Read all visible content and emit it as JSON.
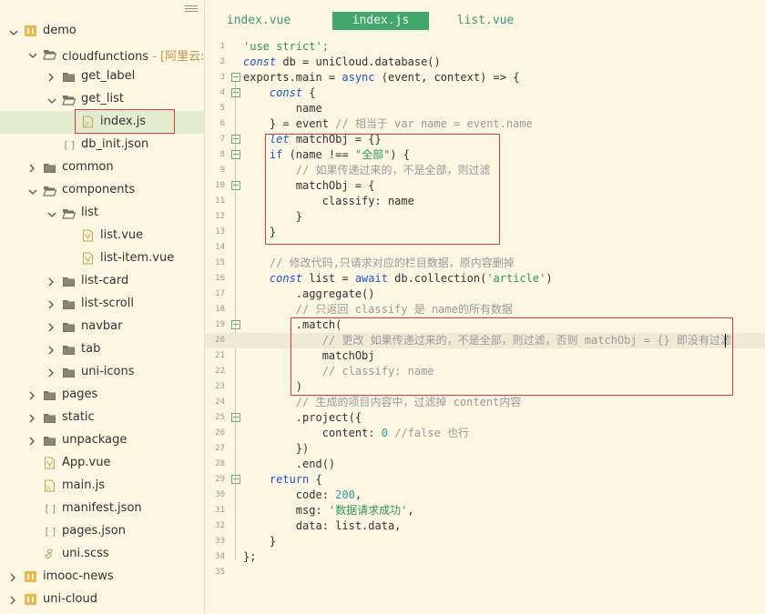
{
  "sidebar": {
    "items": [
      {
        "label": "demo",
        "icon": "project-folder-icon",
        "depth": 0,
        "arrow": "down"
      },
      {
        "label": "cloudfunctions",
        "sub": " - [阿里云:zk",
        "icon": "open-folder-icon",
        "depth": 1,
        "arrow": "down"
      },
      {
        "label": "get_label",
        "icon": "folder-icon",
        "depth": 2,
        "arrow": "right"
      },
      {
        "label": "get_list",
        "icon": "open-folder-icon",
        "depth": 2,
        "arrow": "down"
      },
      {
        "label": "index.js",
        "icon": "js-file-icon",
        "depth": 3,
        "arrow": "",
        "selected": true
      },
      {
        "label": "db_init.json",
        "icon": "json-file-icon",
        "depth": 2,
        "arrow": ""
      },
      {
        "label": "common",
        "icon": "folder-icon",
        "depth": 1,
        "arrow": "right"
      },
      {
        "label": "components",
        "icon": "open-folder-icon",
        "depth": 1,
        "arrow": "down"
      },
      {
        "label": "list",
        "icon": "open-folder-icon",
        "depth": 2,
        "arrow": "down"
      },
      {
        "label": "list.vue",
        "icon": "vue-file-icon",
        "depth": 3,
        "arrow": ""
      },
      {
        "label": "list-item.vue",
        "icon": "vue-file-icon",
        "depth": 3,
        "arrow": ""
      },
      {
        "label": "list-card",
        "icon": "folder-icon",
        "depth": 2,
        "arrow": "right"
      },
      {
        "label": "list-scroll",
        "icon": "folder-icon",
        "depth": 2,
        "arrow": "right"
      },
      {
        "label": "navbar",
        "icon": "folder-icon",
        "depth": 2,
        "arrow": "right"
      },
      {
        "label": "tab",
        "icon": "folder-icon",
        "depth": 2,
        "arrow": "right"
      },
      {
        "label": "uni-icons",
        "icon": "folder-icon",
        "depth": 2,
        "arrow": "right"
      },
      {
        "label": "pages",
        "icon": "folder-icon",
        "depth": 1,
        "arrow": "right"
      },
      {
        "label": "static",
        "icon": "folder-icon",
        "depth": 1,
        "arrow": "right"
      },
      {
        "label": "unpackage",
        "icon": "folder-icon",
        "depth": 1,
        "arrow": "right"
      },
      {
        "label": "App.vue",
        "icon": "vue-file-icon",
        "depth": 1,
        "arrow": ""
      },
      {
        "label": "main.js",
        "icon": "js-file-icon",
        "depth": 1,
        "arrow": ""
      },
      {
        "label": "manifest.json",
        "icon": "json-file-icon",
        "depth": 1,
        "arrow": ""
      },
      {
        "label": "pages.json",
        "icon": "json-file-icon",
        "depth": 1,
        "arrow": ""
      },
      {
        "label": "uni.scss",
        "icon": "scss-file-icon",
        "depth": 1,
        "arrow": ""
      },
      {
        "label": "imooc-news",
        "icon": "project-folder-icon",
        "depth": 0,
        "arrow": "right"
      },
      {
        "label": "uni-cloud",
        "icon": "project-folder-icon",
        "depth": 0,
        "arrow": "right"
      }
    ]
  },
  "tabs": [
    {
      "label": "index.vue",
      "active": false
    },
    {
      "label": "index.js",
      "active": true
    },
    {
      "label": "list.vue",
      "active": false
    }
  ],
  "code": [
    [
      [
        "str",
        "'use strict';"
      ]
    ],
    [
      [
        "kw",
        "const"
      ],
      [
        "txt",
        " db = uniCloud.database()"
      ]
    ],
    [
      [
        "txt",
        "exports.main = "
      ],
      [
        "kw2",
        "async"
      ],
      [
        "txt",
        " (event, context) => {"
      ]
    ],
    [
      [
        "txt",
        "    "
      ],
      [
        "kw",
        "const"
      ],
      [
        "txt",
        " {"
      ]
    ],
    [
      [
        "txt",
        "        name"
      ]
    ],
    [
      [
        "txt",
        "    } = event "
      ],
      [
        "cm",
        "// 相当于 var name = event.name"
      ]
    ],
    [
      [
        "txt",
        "    "
      ],
      [
        "kw",
        "let"
      ],
      [
        "txt",
        " matchObj = {}"
      ]
    ],
    [
      [
        "txt",
        "    "
      ],
      [
        "kw2",
        "if"
      ],
      [
        "txt",
        " (name !== "
      ],
      [
        "str",
        "\"全部\""
      ],
      [
        "txt",
        ") {"
      ]
    ],
    [
      [
        "txt",
        "        "
      ],
      [
        "cm",
        "// 如果传递过来的，不是全部，则过滤"
      ]
    ],
    [
      [
        "txt",
        "        matchObj = {"
      ]
    ],
    [
      [
        "txt",
        "            classify: name"
      ]
    ],
    [
      [
        "txt",
        "        }"
      ]
    ],
    [
      [
        "txt",
        "    }"
      ]
    ],
    [
      [
        "txt",
        ""
      ]
    ],
    [
      [
        "txt",
        "    "
      ],
      [
        "cm",
        "// 修改代码,只请求对应的栏目数据，原内容删掉"
      ]
    ],
    [
      [
        "txt",
        "    "
      ],
      [
        "kw",
        "const"
      ],
      [
        "txt",
        " list = "
      ],
      [
        "kw2",
        "await"
      ],
      [
        "txt",
        " db.collection("
      ],
      [
        "str",
        "'article'"
      ],
      [
        "txt",
        ")"
      ]
    ],
    [
      [
        "txt",
        "        .aggregate()"
      ]
    ],
    [
      [
        "txt",
        "        "
      ],
      [
        "cm",
        "// 只返回 classify 是 name的所有数据"
      ]
    ],
    [
      [
        "txt",
        "        .match("
      ]
    ],
    [
      [
        "txt",
        "            "
      ],
      [
        "cm",
        "// 更改 如果传递过来的，不是全部，则过滤，否则 matchObj = {} 即没有过滤"
      ]
    ],
    [
      [
        "txt",
        "            matchObj"
      ]
    ],
    [
      [
        "txt",
        "            "
      ],
      [
        "cm",
        "// classify: name"
      ]
    ],
    [
      [
        "txt",
        "        )"
      ]
    ],
    [
      [
        "txt",
        "        "
      ],
      [
        "cm",
        "// 生成的项目内容中，过滤掉 content内容"
      ]
    ],
    [
      [
        "txt",
        "        .project({"
      ]
    ],
    [
      [
        "txt",
        "            content: "
      ],
      [
        "num",
        "0"
      ],
      [
        "txt",
        " "
      ],
      [
        "cm",
        "//false 也行"
      ]
    ],
    [
      [
        "txt",
        "        })"
      ]
    ],
    [
      [
        "txt",
        "        .end()"
      ]
    ],
    [
      [
        "txt",
        "    "
      ],
      [
        "kw2",
        "return"
      ],
      [
        "txt",
        " {"
      ]
    ],
    [
      [
        "txt",
        "        code: "
      ],
      [
        "num",
        "200"
      ],
      [
        "txt",
        ","
      ]
    ],
    [
      [
        "txt",
        "        msg: "
      ],
      [
        "str",
        "'数据请求成功'"
      ],
      [
        "txt",
        ","
      ]
    ],
    [
      [
        "txt",
        "        data: list.data,"
      ]
    ],
    [
      [
        "txt",
        "    }"
      ]
    ],
    [
      [
        "txt",
        "};"
      ]
    ],
    [
      [
        "txt",
        ""
      ]
    ]
  ],
  "line_numbers": [
    "1",
    "2",
    "3",
    "4",
    "5",
    "6",
    "7",
    "8",
    "9",
    "10",
    "11",
    "12",
    "13",
    "14",
    "15",
    "16",
    "17",
    "18",
    "19",
    "20",
    "21",
    "22",
    "23",
    "24",
    "25",
    "26",
    "27",
    "28",
    "29",
    "30",
    "31",
    "32",
    "33",
    "34",
    "35"
  ],
  "fold_lines": [
    3,
    4,
    7,
    8,
    10,
    19,
    25,
    29
  ],
  "current_line": 20
}
